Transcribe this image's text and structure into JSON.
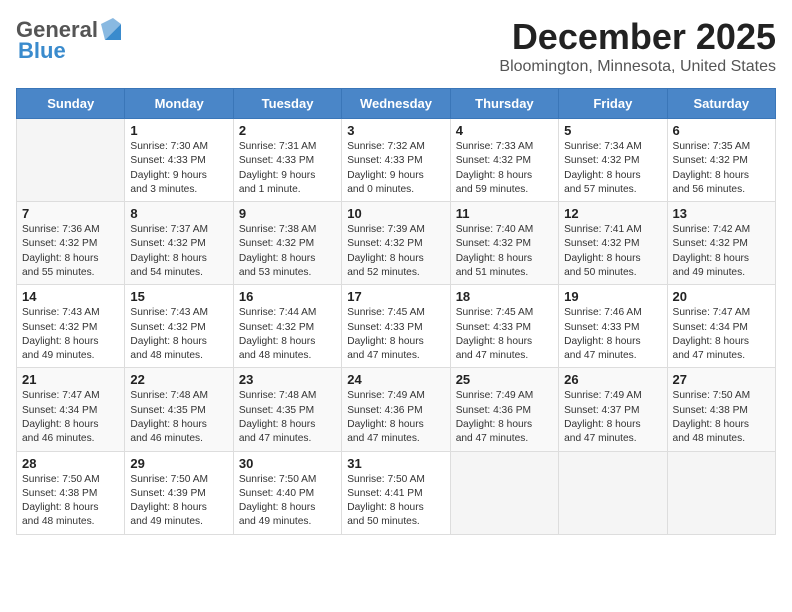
{
  "header": {
    "logo_general": "General",
    "logo_blue": "Blue",
    "month_title": "December 2025",
    "location": "Bloomington, Minnesota, United States"
  },
  "calendar": {
    "days_of_week": [
      "Sunday",
      "Monday",
      "Tuesday",
      "Wednesday",
      "Thursday",
      "Friday",
      "Saturday"
    ],
    "weeks": [
      [
        {
          "day": "",
          "detail": ""
        },
        {
          "day": "1",
          "detail": "Sunrise: 7:30 AM\nSunset: 4:33 PM\nDaylight: 9 hours\nand 3 minutes."
        },
        {
          "day": "2",
          "detail": "Sunrise: 7:31 AM\nSunset: 4:33 PM\nDaylight: 9 hours\nand 1 minute."
        },
        {
          "day": "3",
          "detail": "Sunrise: 7:32 AM\nSunset: 4:33 PM\nDaylight: 9 hours\nand 0 minutes."
        },
        {
          "day": "4",
          "detail": "Sunrise: 7:33 AM\nSunset: 4:32 PM\nDaylight: 8 hours\nand 59 minutes."
        },
        {
          "day": "5",
          "detail": "Sunrise: 7:34 AM\nSunset: 4:32 PM\nDaylight: 8 hours\nand 57 minutes."
        },
        {
          "day": "6",
          "detail": "Sunrise: 7:35 AM\nSunset: 4:32 PM\nDaylight: 8 hours\nand 56 minutes."
        }
      ],
      [
        {
          "day": "7",
          "detail": "Sunrise: 7:36 AM\nSunset: 4:32 PM\nDaylight: 8 hours\nand 55 minutes."
        },
        {
          "day": "8",
          "detail": "Sunrise: 7:37 AM\nSunset: 4:32 PM\nDaylight: 8 hours\nand 54 minutes."
        },
        {
          "day": "9",
          "detail": "Sunrise: 7:38 AM\nSunset: 4:32 PM\nDaylight: 8 hours\nand 53 minutes."
        },
        {
          "day": "10",
          "detail": "Sunrise: 7:39 AM\nSunset: 4:32 PM\nDaylight: 8 hours\nand 52 minutes."
        },
        {
          "day": "11",
          "detail": "Sunrise: 7:40 AM\nSunset: 4:32 PM\nDaylight: 8 hours\nand 51 minutes."
        },
        {
          "day": "12",
          "detail": "Sunrise: 7:41 AM\nSunset: 4:32 PM\nDaylight: 8 hours\nand 50 minutes."
        },
        {
          "day": "13",
          "detail": "Sunrise: 7:42 AM\nSunset: 4:32 PM\nDaylight: 8 hours\nand 49 minutes."
        }
      ],
      [
        {
          "day": "14",
          "detail": "Sunrise: 7:43 AM\nSunset: 4:32 PM\nDaylight: 8 hours\nand 49 minutes."
        },
        {
          "day": "15",
          "detail": "Sunrise: 7:43 AM\nSunset: 4:32 PM\nDaylight: 8 hours\nand 48 minutes."
        },
        {
          "day": "16",
          "detail": "Sunrise: 7:44 AM\nSunset: 4:32 PM\nDaylight: 8 hours\nand 48 minutes."
        },
        {
          "day": "17",
          "detail": "Sunrise: 7:45 AM\nSunset: 4:33 PM\nDaylight: 8 hours\nand 47 minutes."
        },
        {
          "day": "18",
          "detail": "Sunrise: 7:45 AM\nSunset: 4:33 PM\nDaylight: 8 hours\nand 47 minutes."
        },
        {
          "day": "19",
          "detail": "Sunrise: 7:46 AM\nSunset: 4:33 PM\nDaylight: 8 hours\nand 47 minutes."
        },
        {
          "day": "20",
          "detail": "Sunrise: 7:47 AM\nSunset: 4:34 PM\nDaylight: 8 hours\nand 47 minutes."
        }
      ],
      [
        {
          "day": "21",
          "detail": "Sunrise: 7:47 AM\nSunset: 4:34 PM\nDaylight: 8 hours\nand 46 minutes."
        },
        {
          "day": "22",
          "detail": "Sunrise: 7:48 AM\nSunset: 4:35 PM\nDaylight: 8 hours\nand 46 minutes."
        },
        {
          "day": "23",
          "detail": "Sunrise: 7:48 AM\nSunset: 4:35 PM\nDaylight: 8 hours\nand 47 minutes."
        },
        {
          "day": "24",
          "detail": "Sunrise: 7:49 AM\nSunset: 4:36 PM\nDaylight: 8 hours\nand 47 minutes."
        },
        {
          "day": "25",
          "detail": "Sunrise: 7:49 AM\nSunset: 4:36 PM\nDaylight: 8 hours\nand 47 minutes."
        },
        {
          "day": "26",
          "detail": "Sunrise: 7:49 AM\nSunset: 4:37 PM\nDaylight: 8 hours\nand 47 minutes."
        },
        {
          "day": "27",
          "detail": "Sunrise: 7:50 AM\nSunset: 4:38 PM\nDaylight: 8 hours\nand 48 minutes."
        }
      ],
      [
        {
          "day": "28",
          "detail": "Sunrise: 7:50 AM\nSunset: 4:38 PM\nDaylight: 8 hours\nand 48 minutes."
        },
        {
          "day": "29",
          "detail": "Sunrise: 7:50 AM\nSunset: 4:39 PM\nDaylight: 8 hours\nand 49 minutes."
        },
        {
          "day": "30",
          "detail": "Sunrise: 7:50 AM\nSunset: 4:40 PM\nDaylight: 8 hours\nand 49 minutes."
        },
        {
          "day": "31",
          "detail": "Sunrise: 7:50 AM\nSunset: 4:41 PM\nDaylight: 8 hours\nand 50 minutes."
        },
        {
          "day": "",
          "detail": ""
        },
        {
          "day": "",
          "detail": ""
        },
        {
          "day": "",
          "detail": ""
        }
      ]
    ]
  }
}
